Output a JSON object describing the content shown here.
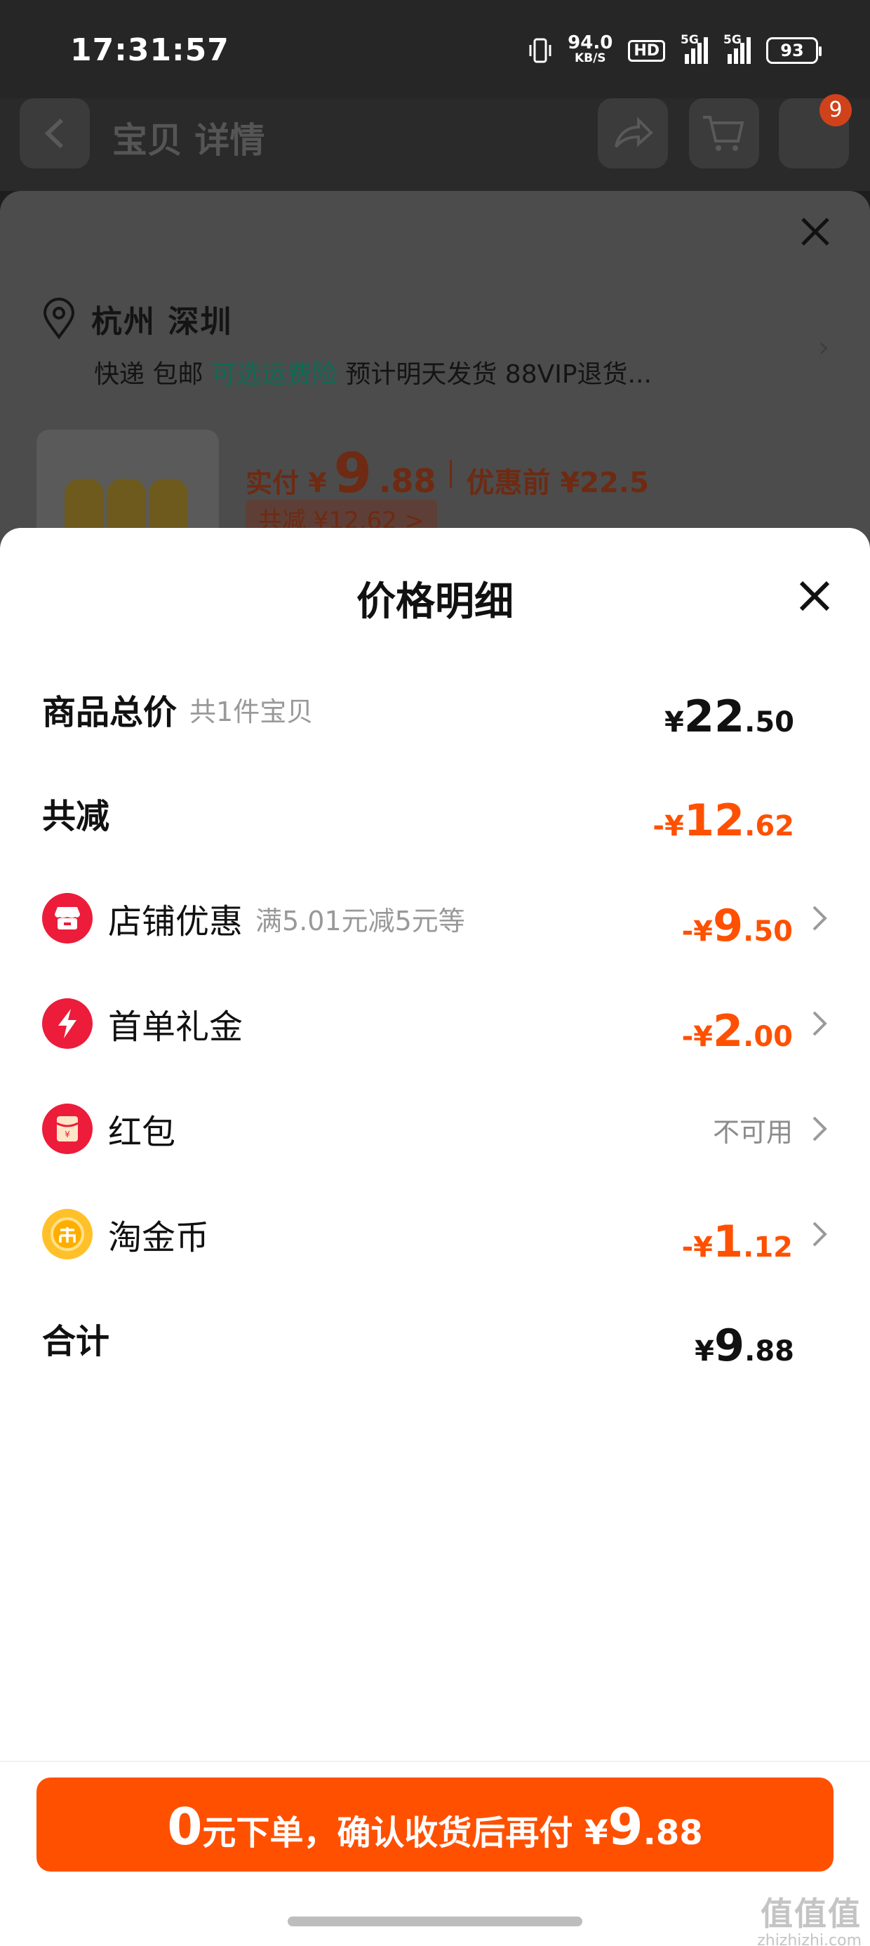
{
  "status_bar": {
    "time": "17:31:57",
    "net_speed": "94.0",
    "net_unit": "KB/S",
    "hd": "HD",
    "sim1": "5G",
    "sim2": "5G",
    "battery": "93"
  },
  "header": {
    "title": "宝贝 详情",
    "cart_count": "9"
  },
  "shipping": {
    "address": "杭州 深圳",
    "line_a": "快递 包邮 ",
    "line_green": "可选运费险",
    "line_b": " 预计明天发货 88VIP退货..."
  },
  "product_price": {
    "label": "实付 ¥",
    "int": "9",
    "dec": ".88",
    "before": "优惠前 ¥22.5",
    "saved": "共减 ¥12.62 >"
  },
  "sheet": {
    "title": "价格明细"
  },
  "rows": {
    "total": {
      "label": "商品总价",
      "hint": "共1件宝贝",
      "sym": "¥",
      "int": "22",
      "dec": ".50"
    },
    "discount": {
      "label": "共减",
      "sym": "-¥",
      "int": "12",
      "dec": ".62"
    },
    "store": {
      "label": "店铺优惠",
      "hint": "满5.01元减5元等",
      "sym": "-¥",
      "int": "9",
      "dec": ".50"
    },
    "first_order": {
      "label": "首单礼金",
      "sym": "-¥",
      "int": "2",
      "dec": ".00"
    },
    "red_packet": {
      "label": "红包",
      "status": "不可用"
    },
    "coin": {
      "label": "淘金币",
      "sym": "-¥",
      "int": "1",
      "dec": ".12"
    },
    "sum": {
      "label": "合计",
      "sym": "¥",
      "int": "9",
      "dec": ".88"
    }
  },
  "pay_button": {
    "zero": "0",
    "text": "元下单，确认收货后再付 ¥",
    "int": "9",
    "dec": ".88"
  },
  "watermark": {
    "brand": "值值值",
    "url": "zhizhizhi.com"
  },
  "colors": {
    "accent": "#ff5000",
    "muted": "#999999"
  },
  "icons": [
    "back-icon",
    "share-icon",
    "cart-icon",
    "close-icon",
    "location-pin-icon",
    "store-icon",
    "lightning-icon",
    "red-packet-icon",
    "coin-icon",
    "chevron-right-icon"
  ]
}
